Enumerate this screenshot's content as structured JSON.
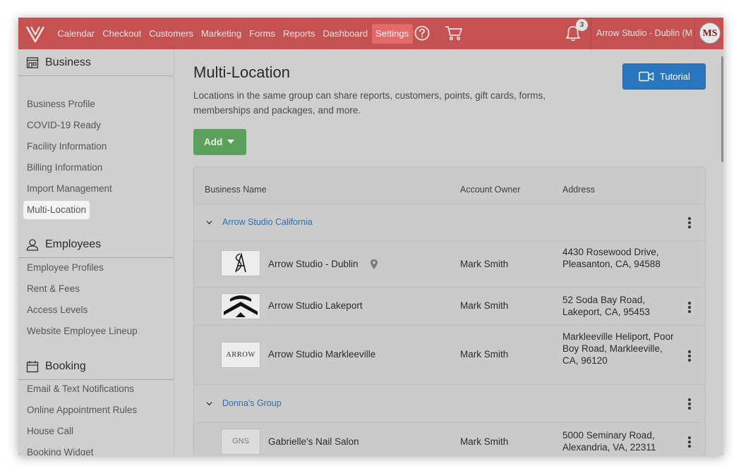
{
  "colors": {
    "topbar": "#c55252",
    "accent_blue": "#2a77bf",
    "add_green": "#5ba05b",
    "link_blue": "#2e6fae"
  },
  "nav": {
    "items": [
      {
        "label": "Calendar"
      },
      {
        "label": "Checkout"
      },
      {
        "label": "Customers"
      },
      {
        "label": "Marketing"
      },
      {
        "label": "Forms"
      },
      {
        "label": "Reports"
      },
      {
        "label": "Dashboard"
      },
      {
        "label": "Settings",
        "active": true
      }
    ],
    "notification_count": "3",
    "studio_name": "Arrow Studio - Dublin (M",
    "avatar_initials": "MS"
  },
  "sidebar": {
    "business": {
      "title": "Business",
      "items": [
        "Business Profile",
        "COVID-19 Ready",
        "Facility Information",
        "Billing Information",
        "Import Management",
        "Multi-Location"
      ]
    },
    "employees": {
      "title": "Employees",
      "items": [
        "Employee Profiles",
        "Rent & Fees",
        "Access Levels",
        "Website Employee Lineup"
      ]
    },
    "booking": {
      "title": "Booking",
      "items": [
        "Email & Text Notifications",
        "Online Appointment Rules",
        "House Call",
        "Booking Widget"
      ]
    }
  },
  "main": {
    "title": "Multi-Location",
    "description": "Locations in the same group can share reports, customers, points, gift cards, forms, memberships and packages, and more.",
    "tutorial_label": "Tutorial",
    "add_label": "Add",
    "table": {
      "headers": {
        "name": "Business Name",
        "owner": "Account Owner",
        "address": "Address"
      },
      "groups": [
        {
          "name": "Arrow Studio California",
          "locations": [
            {
              "name": "Arrow Studio - Dublin",
              "owner": "Mark Smith",
              "address": "4430 Rosewood Drive, Pleasanton, CA, 94588",
              "current": true
            },
            {
              "name": "Arrow Studio Lakeport",
              "owner": "Mark Smith",
              "address": "52 Soda Bay Road, Lakeport, CA, 95453"
            },
            {
              "name": "Arrow Studio Markleeville",
              "owner": "Mark Smith",
              "address": "Markleeville Heliport, Poor Boy Road, Markleeville, CA, 96120",
              "logo_text": "ARROW"
            }
          ]
        },
        {
          "name": "Donna's Group",
          "locations": [
            {
              "name": "Gabrielle's Nail Salon",
              "owner": "Mark Smith",
              "address": "5000 Seminary Road, Alexandria, VA, 22311",
              "logo_text": "GNS"
            }
          ]
        }
      ]
    }
  }
}
